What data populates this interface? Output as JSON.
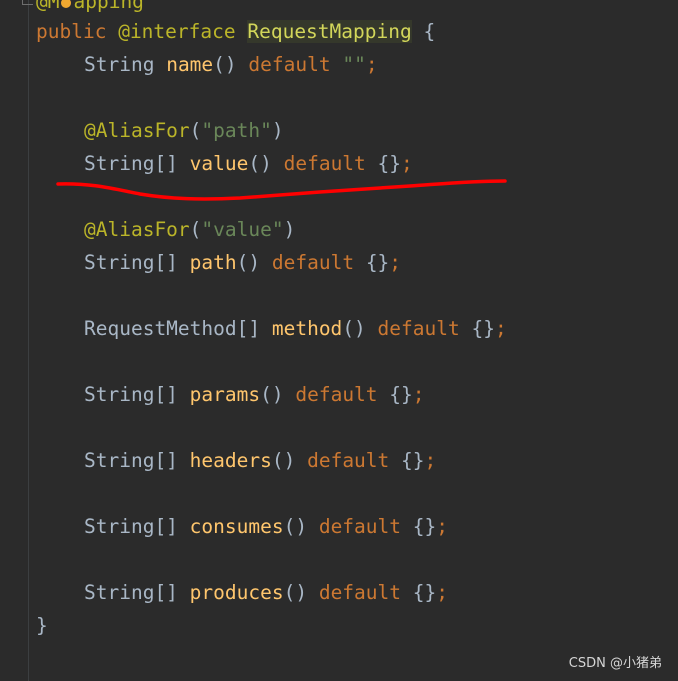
{
  "editor": {
    "top_partial": "@Mapping",
    "decl": {
      "mod": "public",
      "anno_kw": "@interface",
      "name": "RequestMapping",
      "open": "{"
    },
    "lines": [
      {
        "type": "String",
        "name": "name",
        "parens": "()",
        "kw": "default",
        "val": "\"\"",
        "semi": ";"
      },
      {
        "anno": "@AliasFor",
        "arg": "\"path\""
      },
      {
        "type": "String[]",
        "name": "value",
        "parens": "()",
        "kw": "default",
        "val": "{}",
        "semi": ";"
      },
      {
        "anno": "@AliasFor",
        "arg": "\"value\""
      },
      {
        "type": "String[]",
        "name": "path",
        "parens": "()",
        "kw": "default",
        "val": "{}",
        "semi": ";"
      },
      {
        "type": "RequestMethod[]",
        "name": "method",
        "parens": "()",
        "kw": "default",
        "val": "{}",
        "semi": ";"
      },
      {
        "type": "String[]",
        "name": "params",
        "parens": "()",
        "kw": "default",
        "val": "{}",
        "semi": ";"
      },
      {
        "type": "String[]",
        "name": "headers",
        "parens": "()",
        "kw": "default",
        "val": "{}",
        "semi": ";"
      },
      {
        "type": "String[]",
        "name": "consumes",
        "parens": "()",
        "kw": "default",
        "val": "{}",
        "semi": ";"
      },
      {
        "type": "String[]",
        "name": "produces",
        "parens": "()",
        "kw": "default",
        "val": "{}",
        "semi": ";"
      }
    ],
    "close": "}"
  },
  "watermark": "CSDN @小猪弟",
  "colors": {
    "underline": "#ff0000",
    "background": "#2b2b2b"
  }
}
